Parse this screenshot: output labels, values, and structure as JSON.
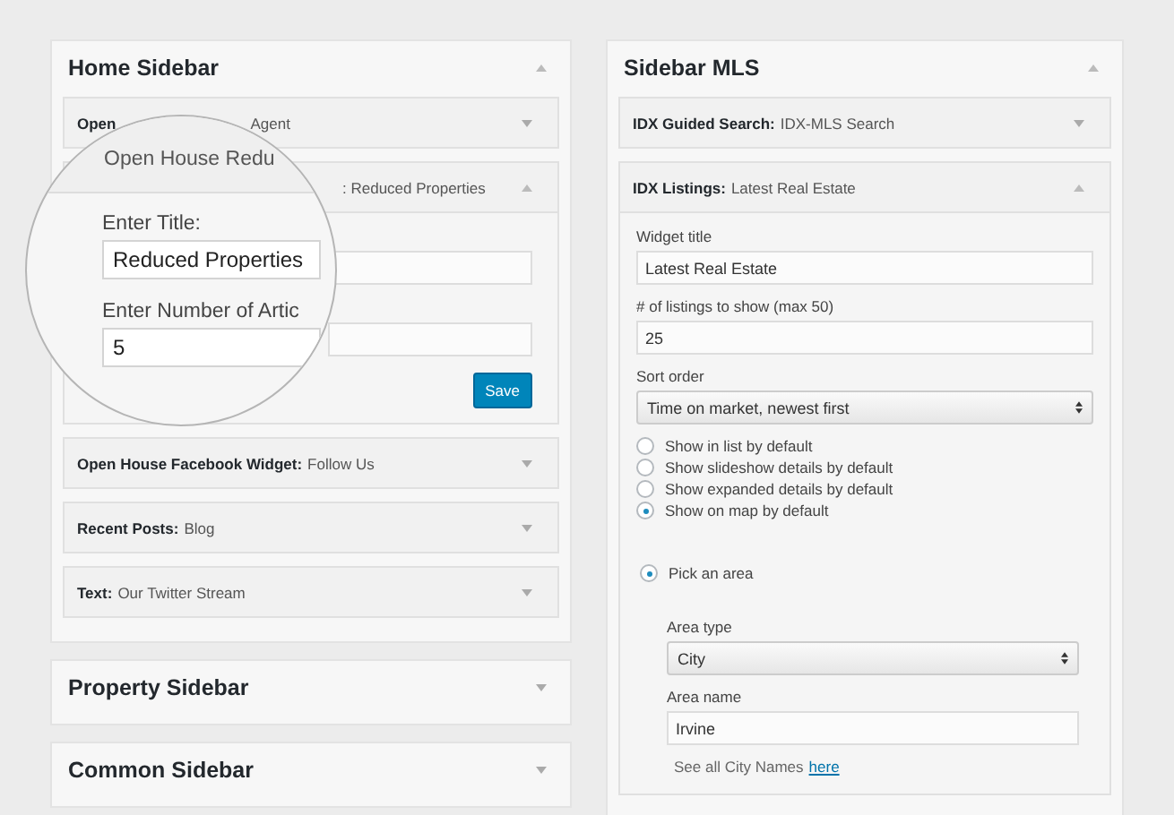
{
  "left_column": [
    {
      "title": "Home Sidebar",
      "expanded": true,
      "widgets": [
        {
          "kind": "split",
          "header_start": "Open",
          "header_end": "Agent",
          "expanded": false
        },
        {
          "kind": "form",
          "header_end": ": Reduced Properties",
          "expanded": true,
          "button": "Save"
        },
        {
          "kind": "plain",
          "name": "Open House Facebook Widget:",
          "title": "Follow Us",
          "expanded": false
        },
        {
          "kind": "plain",
          "name": "Recent Posts:",
          "title": "Blog",
          "expanded": false
        },
        {
          "kind": "plain",
          "name": "Text:",
          "title": "Our Twitter Stream",
          "expanded": false
        }
      ]
    },
    {
      "title": "Property Sidebar",
      "expanded": false
    },
    {
      "title": "Common Sidebar",
      "expanded": false
    }
  ],
  "magnifier": {
    "title": "Open House Redu",
    "fields": [
      {
        "label": "Enter Title:",
        "value": "Reduced Properties"
      },
      {
        "label": "Enter Number of Artic",
        "value": "5"
      }
    ]
  },
  "right_column": {
    "title": "Sidebar MLS",
    "expanded": true,
    "widgets": [
      {
        "name": "IDX Guided Search:",
        "title": "IDX-MLS Search",
        "expanded": false
      },
      {
        "name": "IDX Listings:",
        "title": "Latest Real Estate",
        "expanded": true,
        "form": [
          {
            "kind": "text",
            "label": "Widget title",
            "value": "Latest Real Estate"
          },
          {
            "kind": "text",
            "label": "# of listings to show (max 50)",
            "value": "25"
          },
          {
            "kind": "select",
            "label": "Sort order",
            "value": "Time on market, newest first"
          },
          {
            "kind": "radios",
            "options": [
              {
                "label": "Show in list by default",
                "selected": false
              },
              {
                "label": "Show slideshow details by default",
                "selected": false
              },
              {
                "label": "Show expanded details by default",
                "selected": false
              },
              {
                "label": "Show on map by default",
                "selected": true
              }
            ]
          }
        ],
        "area": {
          "label": "Pick an area",
          "selected": true,
          "fields": [
            {
              "kind": "select",
              "label": "Area type",
              "value": "City"
            },
            {
              "kind": "text",
              "label": "Area name",
              "value": "Irvine"
            }
          ],
          "note": "See all City Names",
          "link": "here"
        }
      }
    ]
  }
}
